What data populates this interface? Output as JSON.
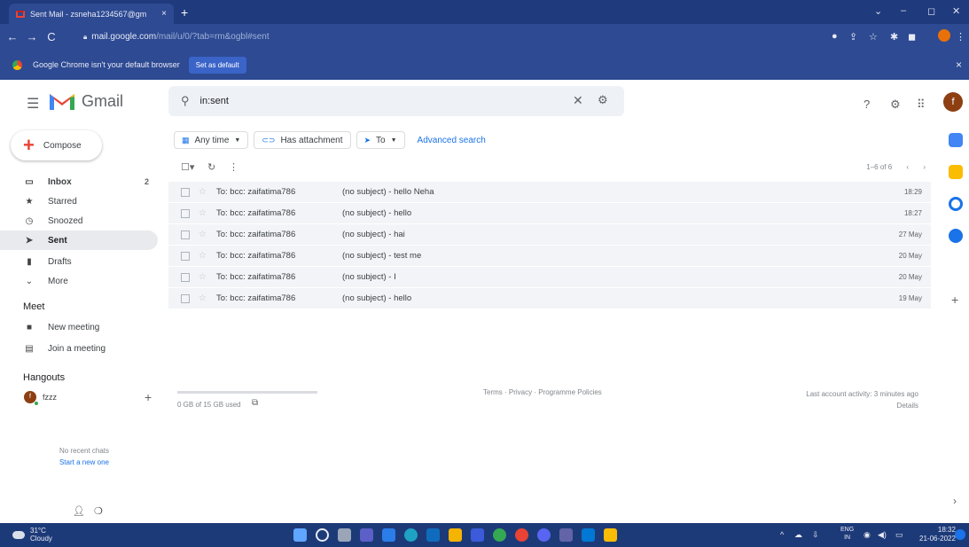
{
  "browser": {
    "tab_title": "Sent Mail - zsneha1234567@gm",
    "tab_close": "×",
    "new_tab": "+",
    "win_min": "‒",
    "win_max": "◻",
    "win_close": "✕",
    "win_menu": "⌄",
    "url_host": "mail.google.com",
    "url_path": "/mail/u/0/?tab=rm&ogbl#sent",
    "infobar_text": "Google Chrome isn't your default browser",
    "set_default_label": "Set as default",
    "infobar_close": "×"
  },
  "gmail": {
    "brand": "Gmail",
    "search_value": "in:sent",
    "avatar_letter": "f"
  },
  "sidebar": {
    "compose_label": "Compose",
    "items": [
      {
        "label": "Inbox",
        "count": "2",
        "icon": "inbox-icon"
      },
      {
        "label": "Starred",
        "icon": "star-icon"
      },
      {
        "label": "Snoozed",
        "icon": "snooze-icon"
      },
      {
        "label": "Sent",
        "icon": "send-icon"
      },
      {
        "label": "Drafts",
        "icon": "draft-icon"
      },
      {
        "label": "More",
        "icon": "chevron-down-icon"
      }
    ],
    "meet_heading": "Meet",
    "meet_items": [
      {
        "label": "New meeting",
        "icon": "video-icon"
      },
      {
        "label": "Join a meeting",
        "icon": "keyboard-icon"
      }
    ],
    "hangouts_heading": "Hangouts",
    "hangout_user": "fzzz",
    "no_recent": "No recent chats",
    "start_new": "Start a new one"
  },
  "filters": {
    "any_time": "Any time",
    "has_attachment": "Has attachment",
    "to": "To",
    "advanced_search": "Advanced search"
  },
  "toolbar": {
    "pagination": "1–6 of 6"
  },
  "emails": [
    {
      "to": "To: bcc: zaifatima786",
      "subject": "(no subject) - hello Neha",
      "date": "18:29"
    },
    {
      "to": "To: bcc: zaifatima786",
      "subject": "(no subject) - hello",
      "date": "18:27"
    },
    {
      "to": "To: bcc: zaifatima786",
      "subject": "(no subject) - hai",
      "date": "27 May"
    },
    {
      "to": "To: bcc: zaifatima786",
      "subject": "(no subject) - test me",
      "date": "20 May"
    },
    {
      "to": "To: bcc: zaifatima786",
      "subject": "(no subject) - I",
      "date": "20 May"
    },
    {
      "to": "To: bcc: zaifatima786",
      "subject": "(no subject) - hello",
      "date": "19 May"
    }
  ],
  "footer": {
    "storage": "0 GB of 15 GB used",
    "links": "Terms · Privacy · Programme Policies",
    "activity": "Last account activity: 3 minutes ago",
    "details": "Details"
  },
  "taskbar": {
    "temp": "31°C",
    "weather": "Cloudy",
    "lang_top": "ENG",
    "lang_bottom": "IN",
    "time": "18:32",
    "date": "21-06-2022"
  },
  "colors": {
    "chrome_frame": "#1f3a7d",
    "gmail_red": "#ea4335",
    "row_bg": "#f2f4f7",
    "link_blue": "#1a73e8"
  }
}
